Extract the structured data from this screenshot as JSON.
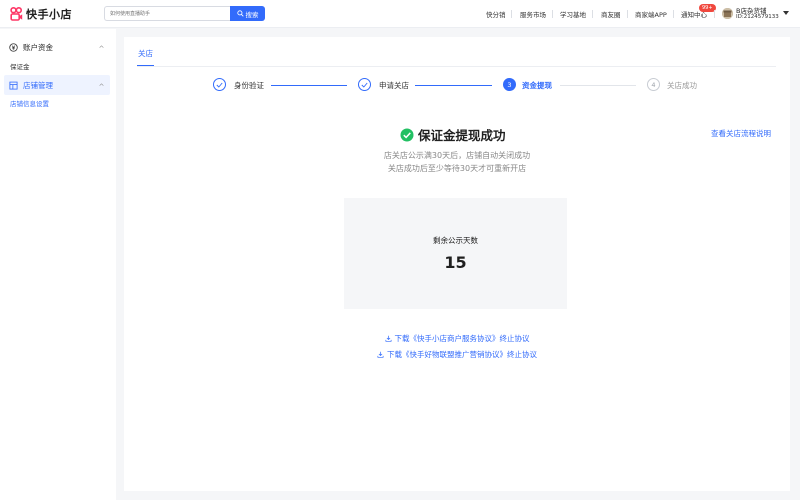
{
  "brand": {
    "name": "快手小店",
    "accent": "#326bfb",
    "logo_color": "#fe3666"
  },
  "search": {
    "placeholder": "如何使用直播助手",
    "button_label": "搜索"
  },
  "nav": {
    "items": [
      "快分销",
      "服务市场",
      "学习基地",
      "商友圈",
      "商家端APP",
      "通知中心"
    ],
    "notification_badge": "99+"
  },
  "account": {
    "store_name": "B店杂货铺",
    "store_id": "ID:2124579133"
  },
  "sidebar": {
    "groups": [
      {
        "label": "账户资金",
        "icon": "yuan-coin-icon",
        "items": [
          "保证金"
        ]
      },
      {
        "label": "店铺管理",
        "icon": "store-icon",
        "items": [
          "店铺信息设置"
        ]
      }
    ]
  },
  "main": {
    "tab": "关店",
    "steps": [
      {
        "label": "身份验证",
        "state": "done"
      },
      {
        "label": "申请关店",
        "state": "done"
      },
      {
        "number": "3",
        "label": "资金提现",
        "state": "current"
      },
      {
        "number": "4",
        "label": "关店成功",
        "state": "todo"
      }
    ],
    "success_title": "保证金提现成功",
    "help_link": "查看关店流程说明",
    "desc_line1": "店关店公示满30天后，店铺自动关闭成功",
    "desc_line2": "关店成功后至少等待30天才可重新开店",
    "counter_label": "剩余公示天数",
    "counter_value": "15",
    "download_links": [
      "下载《快手小店商户服务协议》终止协议",
      "下载《快手好物联盟推广营销协议》终止协议"
    ]
  },
  "colors": {
    "success": "#22c063",
    "line_done": "#326bfb",
    "line_todo": "#e2e5ea"
  }
}
